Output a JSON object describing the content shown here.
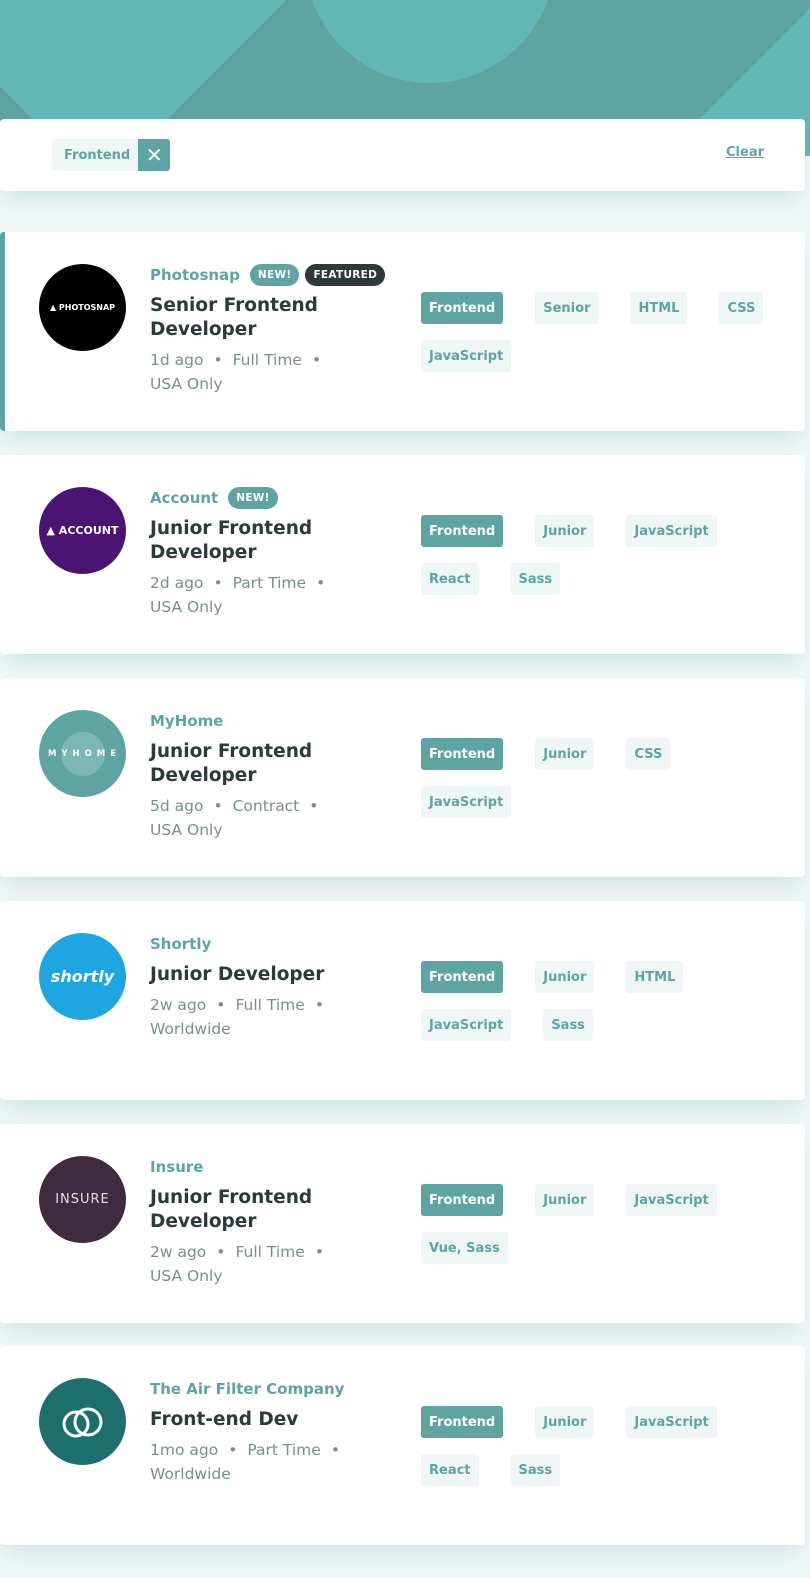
{
  "filters": {
    "active": [
      {
        "label": "Frontend"
      }
    ],
    "clear_label": "Clear"
  },
  "jobs": [
    {
      "company": "Photosnap",
      "logo_text": "▲ PHOTOSNAP",
      "logo_bg": "#000000",
      "badges": [
        "NEW!",
        "FEATURED"
      ],
      "position": "Senior Frontend Developer",
      "posted": "1d ago",
      "contract": "Full Time",
      "location": "USA Only",
      "tags": [
        "Frontend",
        "Senior",
        "HTML",
        "CSS",
        "JavaScript"
      ]
    },
    {
      "company": "Account",
      "logo_text": "▲ ACCOUNT",
      "logo_bg": "#4a1572",
      "badges": [
        "NEW!"
      ],
      "position": "Junior Frontend Developer",
      "posted": "2d ago",
      "contract": "Part Time",
      "location": "USA Only",
      "tags": [
        "Frontend",
        "Junior",
        "JavaScript",
        "React",
        "Sass"
      ]
    },
    {
      "company": "MyHome",
      "logo_text": "M Y H O M E",
      "logo_bg": "#5ea4a3",
      "badges": [],
      "position": "Junior Frontend Developer",
      "posted": "5d ago",
      "contract": "Contract",
      "location": "USA Only",
      "tags": [
        "Frontend",
        "Junior",
        "CSS",
        "JavaScript"
      ]
    },
    {
      "company": "Shortly",
      "logo_text": "shortly",
      "logo_bg": "#1fa6e0",
      "badges": [],
      "position": "Junior Developer",
      "posted": "2w ago",
      "contract": "Full Time",
      "location": "Worldwide",
      "tags": [
        "Frontend",
        "Junior",
        "HTML",
        "JavaScript",
        "Sass"
      ]
    },
    {
      "company": "Insure",
      "logo_text": "INSURE",
      "logo_bg": "#3e2b40",
      "badges": [],
      "position": "Junior Frontend Developer",
      "posted": "2w ago",
      "contract": "Full Time",
      "location": "USA Only",
      "tags": [
        "Frontend",
        "Junior",
        "JavaScript",
        "Vue, Sass"
      ]
    },
    {
      "company": "The Air Filter Company",
      "logo_text": "",
      "logo_bg": "#1d6f6d",
      "badges": [],
      "position": "Front-end Dev",
      "posted": "1mo ago",
      "contract": "Part Time",
      "location": "Worldwide",
      "tags": [
        "Frontend",
        "Junior",
        "JavaScript",
        "React",
        "Sass"
      ]
    }
  ],
  "colors": {
    "accent": "#5ea4a3",
    "dark": "#2c3a3a",
    "background": "#eff7f7",
    "tag_bg": "#eef6f6"
  }
}
